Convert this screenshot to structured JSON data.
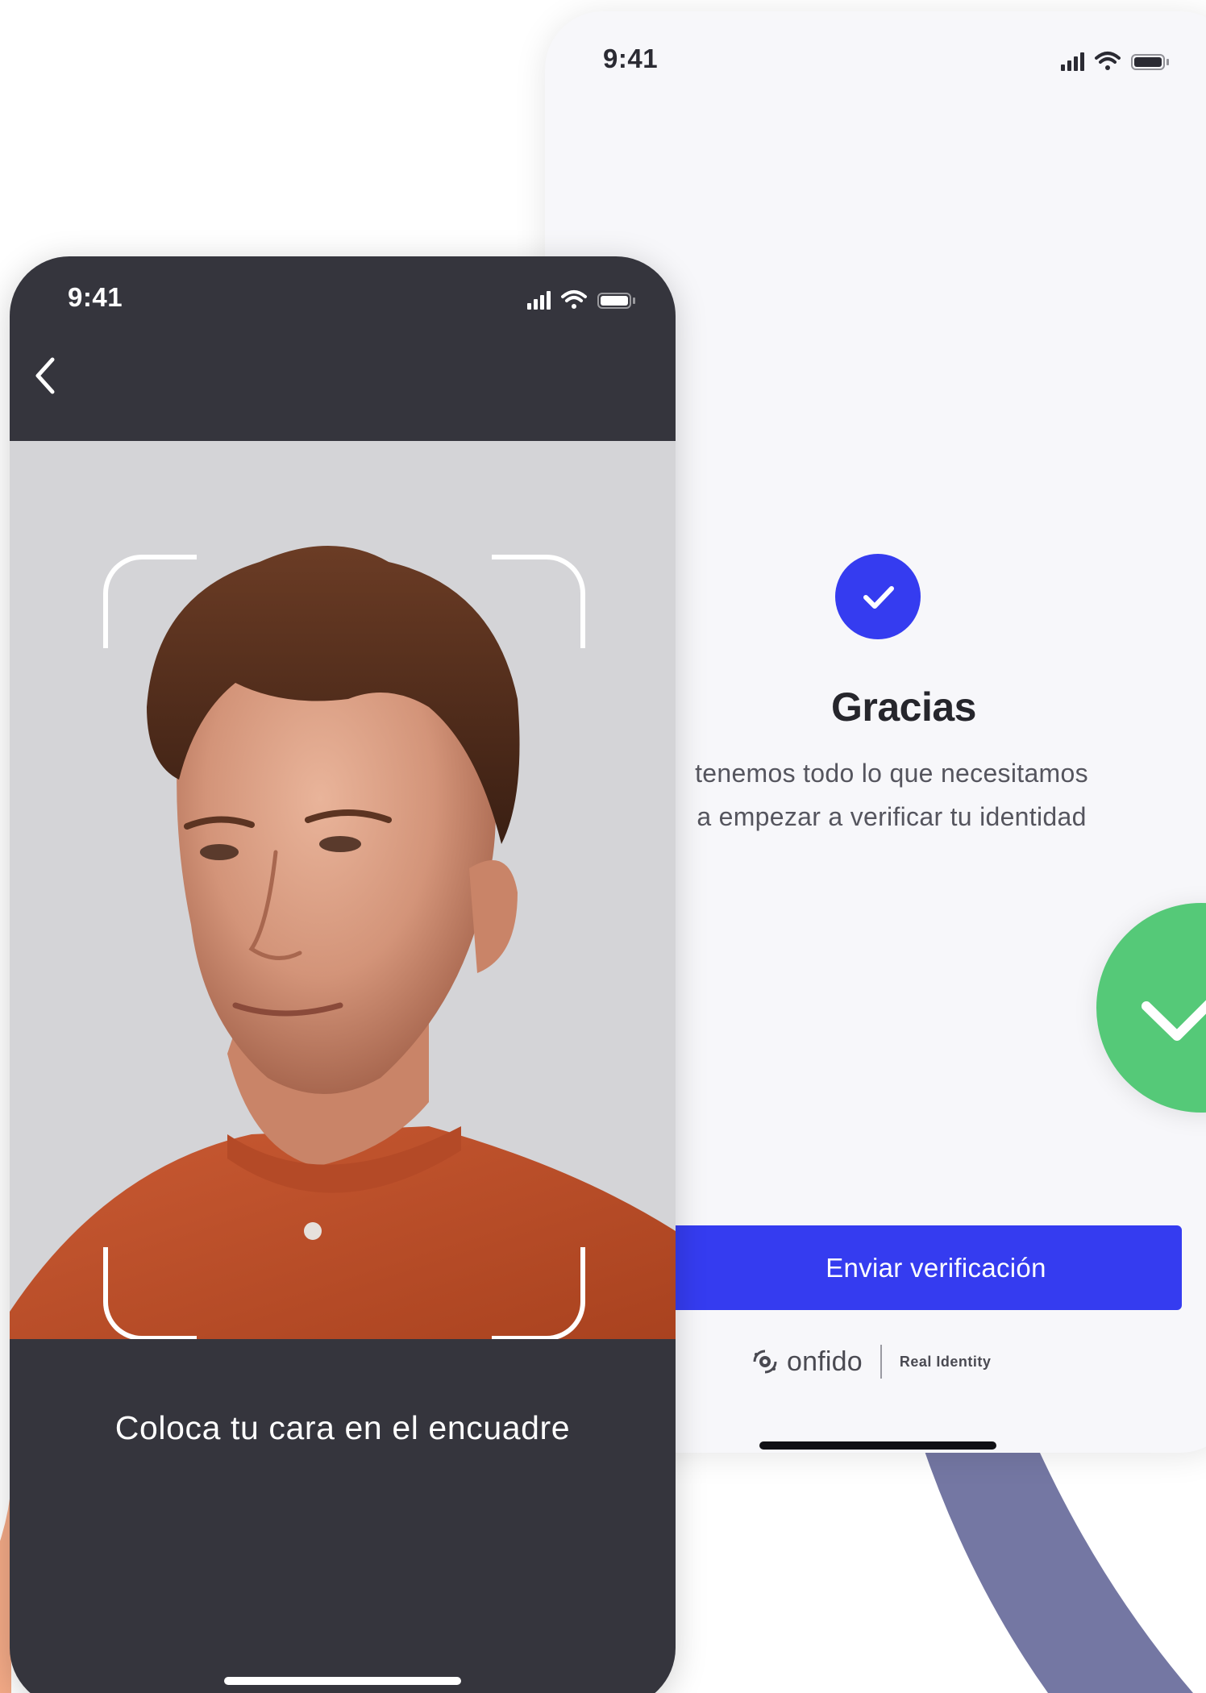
{
  "back_phone": {
    "status_time": "9:41",
    "title": "Gracias",
    "description_line1": "tenemos todo lo que necesitamos",
    "description_line2": "a empezar a verificar tu identidad",
    "send_button_label": "Enviar verificación",
    "brand_name": "onfido",
    "brand_tagline": "Real Identity"
  },
  "front_phone": {
    "status_time": "9:41",
    "instruction": "Coloca tu cara en el encuadre"
  },
  "colors": {
    "accent_blue": "#353cf0",
    "success_green": "#55c978",
    "dark_surface": "#35353d",
    "shirt_orange": "#c0512e"
  },
  "icons": [
    "signal-icon",
    "wifi-icon",
    "battery-icon",
    "back-chevron-icon",
    "checkmark-icon",
    "onfido-logo-icon"
  ]
}
